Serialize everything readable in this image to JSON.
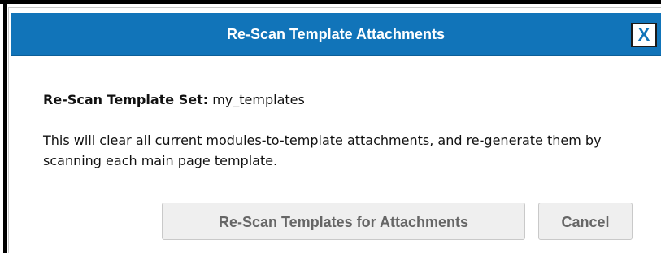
{
  "dialog": {
    "title": "Re-Scan Template Attachments",
    "close_label": "X",
    "set_label": "Re-Scan Template Set:",
    "set_value": "my_templates",
    "description": "This will clear all current modules-to-template attachments, and re-generate them by scanning each main page template."
  },
  "actions": {
    "rescan_label": "Re-Scan Templates for Attachments",
    "cancel_label": "Cancel"
  },
  "colors": {
    "titlebar": "#1174b9",
    "title_text": "#ffffff",
    "button_background": "#efefef",
    "button_text": "#666666"
  }
}
